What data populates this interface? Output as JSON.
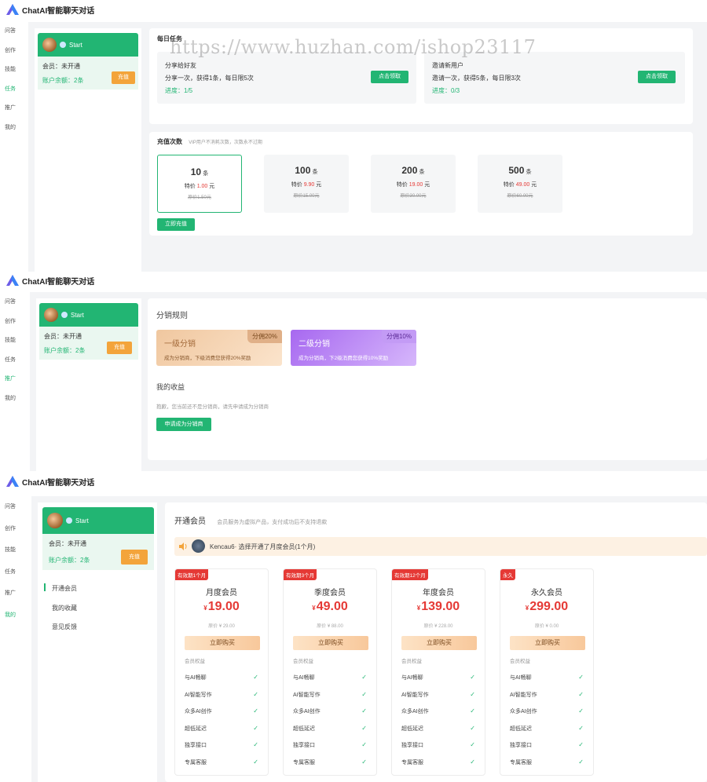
{
  "app": {
    "title": "ChatAI智能聊天对话"
  },
  "nav": [
    "问答",
    "创作",
    "技能",
    "任务",
    "推广",
    "我的"
  ],
  "user": {
    "name": "Start",
    "member_label": "会员：未开通",
    "balance_label": "账户余额：2条",
    "recharge_btn": "充值"
  },
  "tasks": {
    "title": "每日任务",
    "items": [
      {
        "title": "分享给好友",
        "desc": "分享一次，获得1条，每日限5次",
        "progress": "进度：1/5",
        "btn": "点击领取"
      },
      {
        "title": "邀请新用户",
        "desc": "邀请一次，获得5条，每日限3次",
        "progress": "进度：0/3",
        "btn": "点击领取"
      }
    ]
  },
  "recharge": {
    "title": "充值次数",
    "subtitle": "VIP用户不消耗次数，次数永不过期",
    "unit": "条",
    "sale_prefix": "特价",
    "yuan": "元",
    "packages": [
      {
        "count": "10",
        "price": "1.00",
        "orig": "原价1.50元",
        "selected": true
      },
      {
        "count": "100",
        "price": "9.90",
        "orig": "原价15.00元",
        "selected": false
      },
      {
        "count": "200",
        "price": "19.00",
        "orig": "原价30.00元",
        "selected": false
      },
      {
        "count": "500",
        "price": "49.00",
        "orig": "原价60.00元",
        "selected": false
      }
    ],
    "btn": "立即充值"
  },
  "distribution": {
    "title": "分销规则",
    "tiers": [
      {
        "name": "一级分销",
        "badge": "分佣20%",
        "desc": "成为分销商，下级消费您获得20%奖励"
      },
      {
        "name": "二级分销",
        "badge": "分佣10%",
        "desc": "成为分销商，下2级消费您获得10%奖励"
      }
    ],
    "earnings_title": "我的收益",
    "earnings_note": "抱歉，您当前还不是分销商，请先申请成为分销商",
    "apply_btn": "申请成为分销商"
  },
  "membership": {
    "menu": [
      "开通会员",
      "我的收藏",
      "意见反馈"
    ],
    "title": "开通会员",
    "note": "会员服务为虚拟产品，支付成功后不支持退款",
    "notice_user": "Kencau6",
    "notice_text": "· 选择开通了月度会员(1个月)",
    "currency": "¥",
    "buy_btn": "立即购买",
    "rights_label": "会员权益",
    "features": [
      "与AI畅聊",
      "AI智能写作",
      "众多AI创作",
      "超低延迟",
      "独享接口",
      "专属客服"
    ],
    "plans": [
      {
        "tag": "有效期1个月",
        "name": "月度会员",
        "price": "19.00",
        "orig": "原价 ¥ 29.00"
      },
      {
        "tag": "有效期3个月",
        "name": "季度会员",
        "price": "49.00",
        "orig": "原价 ¥ 88.00"
      },
      {
        "tag": "有效期12个月",
        "name": "年度会员",
        "price": "139.00",
        "orig": "原价 ¥ 228.00"
      },
      {
        "tag": "永久",
        "name": "永久会员",
        "price": "299.00",
        "orig": "原价 ¥ 0.00"
      }
    ]
  },
  "watermark": "https://www.huzhan.com/ishop23117"
}
